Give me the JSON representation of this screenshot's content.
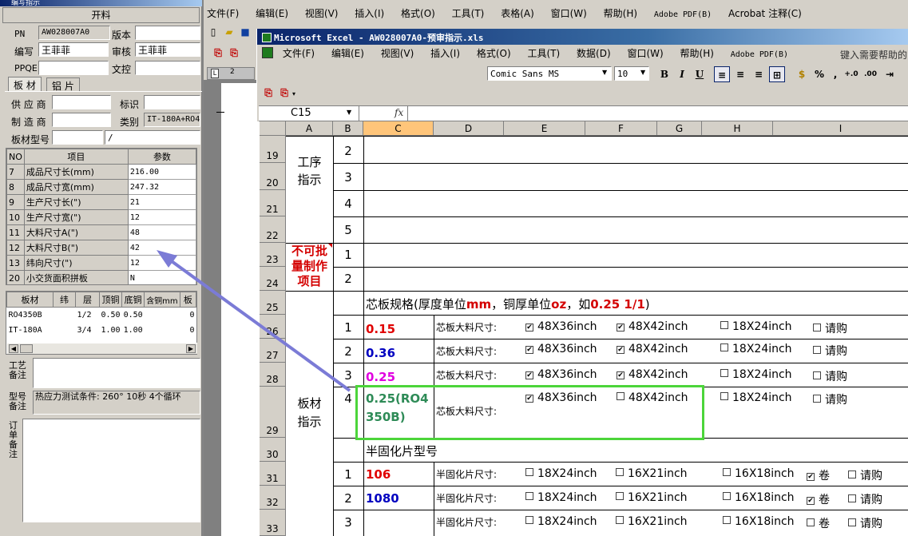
{
  "left_panel": {
    "title": "编写指示",
    "header": "开料",
    "fields": {
      "pn_label": "PN",
      "pn_value": "AW028007A0",
      "version_label": "版本",
      "version_value": "",
      "author_label": "编写",
      "author_value": "王菲菲",
      "review_label": "审核",
      "review_value": "王菲菲",
      "ppqe_label": "PPQE",
      "ppqe_value": "",
      "wenkong_label": "文控",
      "wenkong_value": ""
    },
    "tabs": [
      "板 材",
      "铝 片"
    ],
    "supplier": {
      "supplier_label": "供 应 商",
      "supplier_value": "",
      "mark_label": "标识",
      "mark_value": "",
      "maker_label": "制 造 商",
      "maker_value": "",
      "type_label": "类别",
      "type_value": "IT-180A+RO43",
      "model_label": "板材型号",
      "model_value": "",
      "model_sep": "/"
    },
    "param_table": {
      "headers": [
        "NO",
        "项目",
        "参数"
      ],
      "rows": [
        [
          "7",
          "成品尺寸长(mm)",
          "216.00"
        ],
        [
          "8",
          "成品尺寸宽(mm)",
          "247.32"
        ],
        [
          "9",
          "生产尺寸长(\")",
          "21"
        ],
        [
          "10",
          "生产尺寸宽(\")",
          "12"
        ],
        [
          "11",
          "大料尺寸A(\")",
          "48"
        ],
        [
          "12",
          "大料尺寸B(\")",
          "42"
        ],
        [
          "13",
          "纬向尺寸(\")",
          "12"
        ],
        [
          "20",
          "小交货面积拼板",
          "N"
        ]
      ]
    },
    "material_table": {
      "headers": [
        "板材",
        "纬",
        "层",
        "顶铜",
        "底铜",
        "含铜mm",
        "板"
      ],
      "rows": [
        [
          "RO4350B",
          "",
          "1/2",
          "0.50",
          "0.50",
          "",
          "0"
        ],
        [
          "IT-180A",
          "",
          "3/4",
          "1.00",
          "1.00",
          "",
          "0"
        ]
      ]
    },
    "process_note_label": "工艺\n备注",
    "model_note_label": "型号\n备注",
    "model_note_value": "热应力测试条件: 260° 10秒 4个循环",
    "order_note_label": "订\n单\n备\n注"
  },
  "word": {
    "menu": [
      "文件(F)",
      "编辑(E)",
      "视图(V)",
      "插入(I)",
      "格式(O)",
      "工具(T)",
      "表格(A)",
      "窗口(W)",
      "帮助(H)",
      "Adobe PDF(B)",
      "Acrobat 注释(C)"
    ],
    "ruler_mark": "2"
  },
  "excel": {
    "title": "Microsoft Excel - AW028007A0-预审指示.xls",
    "menu": [
      "文件(F)",
      "编辑(E)",
      "视图(V)",
      "插入(I)",
      "格式(O)",
      "工具(T)",
      "数据(D)",
      "窗口(W)",
      "帮助(H)",
      "Adobe PDF(B)"
    ],
    "help_placeholder": "键入需要帮助的",
    "font_name": "Comic Sans MS",
    "font_size": "10",
    "name_box": "C15",
    "fx": "fx",
    "columns": [
      "A",
      "B",
      "C",
      "D",
      "E",
      "F",
      "G",
      "H",
      "I"
    ],
    "rows": {
      "r19": "19",
      "r20": "20",
      "r21": "21",
      "r22": "22",
      "r23": "23",
      "r24": "24",
      "r25": "25",
      "r26": "26",
      "r27": "27",
      "r28": "28",
      "r29": "29",
      "r30": "30",
      "r31": "31",
      "r32": "32",
      "r33": "33"
    },
    "cells": {
      "a_process": "工序\n指示",
      "a_nobatch": "不可批\n量制作\n项目",
      "a_material": "板材\n指示",
      "b19": "2",
      "b20": "3",
      "b21": "4",
      "b22": "5",
      "b23": "1",
      "b24": "2",
      "core_spec": "芯板规格(厚度单位mm，铜厚单位oz，如0.25 1/1)",
      "core_spec_pre": "芯板规格(厚度单位",
      "core_spec_mm": "mm",
      "core_spec_mid": "，铜厚单位",
      "core_spec_oz": "oz",
      "core_spec_mid2": "，如",
      "core_spec_ex": "0.25 1/1",
      "core_spec_end": ")",
      "core_rows": [
        {
          "b": "1",
          "c": "0.15",
          "color": "#e00000",
          "d": "芯板大料尺寸:",
          "e": "48X36inch",
          "e_chk": true,
          "f": "48X42inch",
          "f_chk": true,
          "h": "18X24inch",
          "h_chk": false,
          "i": "请购",
          "i_chk": false
        },
        {
          "b": "2",
          "c": "0.36",
          "color": "#0000c0",
          "d": "芯板大料尺寸:",
          "e": "48X36inch",
          "e_chk": true,
          "f": "48X42inch",
          "f_chk": true,
          "h": "18X24inch",
          "h_chk": false,
          "i": "请购",
          "i_chk": false
        },
        {
          "b": "3",
          "c": "0.25",
          "color": "#e000e0",
          "d": "芯板大料尺寸:",
          "e": "48X36inch",
          "e_chk": true,
          "f": "48X42inch",
          "f_chk": true,
          "h": "18X24inch",
          "h_chk": false,
          "i": "请购",
          "i_chk": false
        },
        {
          "b": "4",
          "c": "0.25(RO4\n350B)",
          "color": "#2e8b57",
          "d": "芯板大料尺寸:",
          "e": "48X36inch",
          "e_chk": true,
          "f": "48X42inch",
          "f_chk": false,
          "h": "18X24inch",
          "h_chk": false,
          "i": "请购",
          "i_chk": false
        }
      ],
      "prepreg_title": "半固化片型号",
      "prepreg_rows": [
        {
          "b": "1",
          "c": "106",
          "color": "#e00000",
          "d": "半固化片尺寸:",
          "e": "18X24inch",
          "f": "16X21inch",
          "h": "16X18inch",
          "roll": "卷",
          "roll_chk": true,
          "i": "请购"
        },
        {
          "b": "2",
          "c": "1080",
          "color": "#0000c0",
          "d": "半固化片尺寸:",
          "e": "18X24inch",
          "f": "16X21inch",
          "h": "16X18inch",
          "roll": "卷",
          "roll_chk": true,
          "i": "请购"
        },
        {
          "b": "3",
          "c": "",
          "color": "#000000",
          "d": "半固化片尺寸:",
          "e": "18X24inch",
          "f": "16X21inch",
          "h": "16X18inch",
          "roll": "卷",
          "roll_chk": false,
          "i": "请购"
        }
      ]
    }
  },
  "colors": {
    "highlight_box": "#4cd53a",
    "arrow": "#7b7bd6",
    "selected_col": "#ffc57a",
    "red_text": "#d40000"
  }
}
